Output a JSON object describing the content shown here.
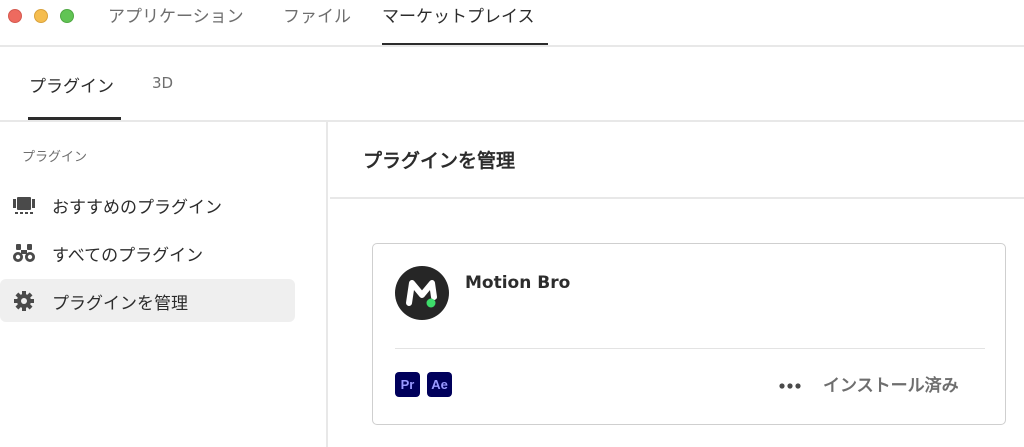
{
  "window": {
    "tabs": [
      {
        "label": "アプリケーション"
      },
      {
        "label": "ファイル"
      },
      {
        "label": "マーケットプレイス",
        "active": true
      }
    ]
  },
  "subtabs": [
    {
      "label": "プラグイン",
      "active": true
    },
    {
      "label": "3D"
    }
  ],
  "sidebar": {
    "heading": "プラグイン",
    "items": [
      {
        "label": "おすすめのプラグイン",
        "icon": "featured-icon"
      },
      {
        "label": "すべてのプラグイン",
        "icon": "binoculars-icon"
      },
      {
        "label": "プラグインを管理",
        "icon": "gear-icon",
        "selected": true
      }
    ]
  },
  "content": {
    "title": "プラグインを管理"
  },
  "plugin_card": {
    "name": "Motion Bro",
    "apps": [
      "Pr",
      "Ae"
    ],
    "status": "インストール済み",
    "more_icon": "more-dots-icon"
  },
  "colors": {
    "accent_text": "#2c2c2c",
    "muted_text": "#6e6e6e",
    "selected_bg": "#efefef",
    "app_badge_bg": "#00005b",
    "app_badge_text": "#9999ff",
    "logo_green": "#3ddc6a"
  }
}
